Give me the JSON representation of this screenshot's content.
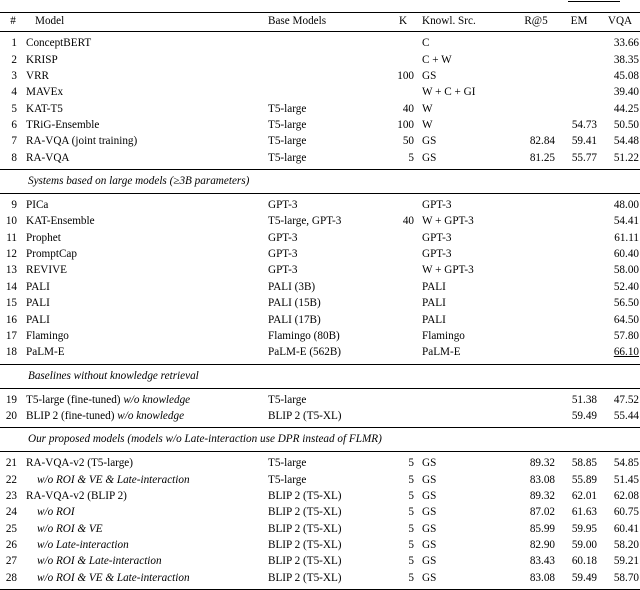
{
  "table": {
    "columns": [
      "#",
      "Model",
      "Base Models",
      "K",
      "Knowl. Src.",
      "R@5",
      "EM",
      "VQA"
    ],
    "clipped_top_row": {
      "cells": [
        "",
        "",
        "",
        "",
        "",
        "",
        "",
        ""
      ]
    },
    "sections": [
      {
        "title": null,
        "rows": [
          {
            "num": "1",
            "model": "ConceptBERT",
            "base": "",
            "k": "",
            "ksrc": "C",
            "r5": "",
            "em": "",
            "vqa": "33.66"
          },
          {
            "num": "2",
            "model": "KRISP",
            "base": "",
            "k": "",
            "ksrc": "C + W",
            "r5": "",
            "em": "",
            "vqa": "38.35"
          },
          {
            "num": "3",
            "model": "VRR",
            "base": "",
            "k": "100",
            "ksrc": "GS",
            "r5": "",
            "em": "",
            "vqa": "45.08"
          },
          {
            "num": "4",
            "model": "MAVEx",
            "base": "",
            "k": "",
            "ksrc": "W + C + GI",
            "r5": "",
            "em": "",
            "vqa": "39.40"
          },
          {
            "num": "5",
            "model": "KAT-T5",
            "base": "T5-large",
            "k": "40",
            "ksrc": "W",
            "r5": "",
            "em": "",
            "vqa": "44.25"
          },
          {
            "num": "6",
            "model": "TRiG-Ensemble",
            "base": "T5-large",
            "k": "100",
            "ksrc": "W",
            "r5": "",
            "em": "54.73",
            "vqa": "50.50"
          },
          {
            "num": "7",
            "model": "RA-VQA (joint training)",
            "base": "T5-large",
            "k": "50",
            "ksrc": "GS",
            "r5": "82.84",
            "em": "59.41",
            "vqa": "54.48"
          },
          {
            "num": "8",
            "model": "RA-VQA",
            "base": "T5-large",
            "k": "5",
            "ksrc": "GS",
            "r5": "81.25",
            "em": "55.77",
            "vqa": "51.22"
          }
        ]
      },
      {
        "title": "Systems based on large models (≥3B parameters)",
        "rows": [
          {
            "num": "9",
            "model": "PICa",
            "base": "GPT-3",
            "k": "",
            "ksrc": "GPT-3",
            "r5": "",
            "em": "",
            "vqa": "48.00"
          },
          {
            "num": "10",
            "model": "KAT-Ensemble",
            "base": "T5-large, GPT-3",
            "k": "40",
            "ksrc": "W + GPT-3",
            "r5": "",
            "em": "",
            "vqa": "54.41"
          },
          {
            "num": "11",
            "model": "Prophet",
            "base": "GPT-3",
            "k": "",
            "ksrc": "GPT-3",
            "r5": "",
            "em": "",
            "vqa": "61.11"
          },
          {
            "num": "12",
            "model": "PromptCap",
            "base": "GPT-3",
            "k": "",
            "ksrc": "GPT-3",
            "r5": "",
            "em": "",
            "vqa": "60.40"
          },
          {
            "num": "13",
            "model": "REVIVE",
            "base": "GPT-3",
            "k": "",
            "ksrc": "W + GPT-3",
            "r5": "",
            "em": "",
            "vqa": "58.00"
          },
          {
            "num": "14",
            "model": "PALI",
            "base": "PALI (3B)",
            "k": "",
            "ksrc": "PALI",
            "r5": "",
            "em": "",
            "vqa": "52.40"
          },
          {
            "num": "15",
            "model": "PALI",
            "base": "PALI (15B)",
            "k": "",
            "ksrc": "PALI",
            "r5": "",
            "em": "",
            "vqa": "56.50"
          },
          {
            "num": "16",
            "model": "PALI",
            "base": "PALI (17B)",
            "k": "",
            "ksrc": "PALI",
            "r5": "",
            "em": "",
            "vqa": "64.50"
          },
          {
            "num": "17",
            "model": "Flamingo",
            "base": "Flamingo (80B)",
            "k": "",
            "ksrc": "Flamingo",
            "r5": "",
            "em": "",
            "vqa": "57.80"
          },
          {
            "num": "18",
            "model": "PaLM-E",
            "base": "PaLM-E (562B)",
            "k": "",
            "ksrc": "PaLM-E",
            "r5": "",
            "em": "",
            "vqa": "66.10",
            "vqa_style": "underline"
          }
        ]
      },
      {
        "title": "Baselines without knowledge retrieval",
        "rows": [
          {
            "num": "19",
            "model": "T5-large (fine-tuned) ",
            "model_italic": "w/o knowledge",
            "base": "T5-large",
            "k": "",
            "ksrc": "",
            "r5": "",
            "em": "51.38",
            "vqa": "47.52"
          },
          {
            "num": "20",
            "model": "BLIP 2 (fine-tuned) ",
            "model_italic": "w/o knowledge",
            "base": "BLIP 2 (T5-XL)",
            "k": "",
            "ksrc": "",
            "r5": "",
            "em": "59.49",
            "vqa": "55.44"
          }
        ]
      },
      {
        "title": "Our proposed models (models w/o Late-interaction use DPR instead of FLMR)",
        "rows": [
          {
            "num": "21",
            "model": "RA-VQA-v2 (T5-large)",
            "base": "T5-large",
            "k": "5",
            "ksrc": "GS",
            "r5": "89.32",
            "em": "58.85",
            "vqa": "54.85"
          },
          {
            "num": "22",
            "model": "",
            "model_italic": "w/o ROI & VE & Late-interaction",
            "indent": true,
            "base": "T5-large",
            "k": "5",
            "ksrc": "GS",
            "r5": "83.08",
            "em": "55.89",
            "vqa": "51.45"
          },
          {
            "num": "23",
            "model": "RA-VQA-v2 (BLIP 2)",
            "base": "BLIP 2 (T5-XL)",
            "k": "5",
            "ksrc": "GS",
            "r5": "89.32",
            "em": "62.01",
            "vqa": "62.08",
            "bold_metrics": true
          },
          {
            "num": "24",
            "model": "",
            "model_italic": "w/o ROI",
            "indent": true,
            "base": "BLIP 2 (T5-XL)",
            "k": "5",
            "ksrc": "GS",
            "r5": "87.02",
            "em": "61.63",
            "vqa": "60.75"
          },
          {
            "num": "25",
            "model": "",
            "model_italic": "w/o ROI & VE",
            "indent": true,
            "base": "BLIP 2 (T5-XL)",
            "k": "5",
            "ksrc": "GS",
            "r5": "85.99",
            "em": "59.95",
            "vqa": "60.41"
          },
          {
            "num": "26",
            "model": "",
            "model_italic": "w/o Late-interaction",
            "indent": true,
            "base": "BLIP 2 (T5-XL)",
            "k": "5",
            "ksrc": "GS",
            "r5": "82.90",
            "em": "59.00",
            "vqa": "58.20"
          },
          {
            "num": "27",
            "model": "",
            "model_italic": "w/o ROI & Late-interaction",
            "indent": true,
            "base": "BLIP 2 (T5-XL)",
            "k": "5",
            "ksrc": "GS",
            "r5": "83.43",
            "em": "60.18",
            "vqa": "59.21"
          },
          {
            "num": "28",
            "model": "",
            "model_italic": "w/o ROI & VE & Late-interaction",
            "indent": true,
            "base": "BLIP 2 (T5-XL)",
            "k": "5",
            "ksrc": "GS",
            "r5": "83.08",
            "em": "59.49",
            "vqa": "58.70"
          }
        ]
      }
    ]
  }
}
